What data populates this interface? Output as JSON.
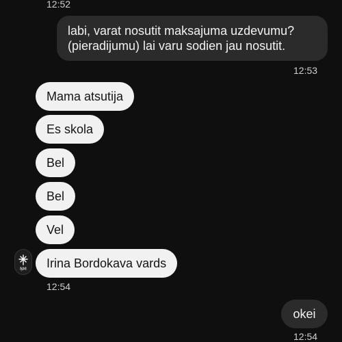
{
  "messages": {
    "ts_top": "12:52",
    "outgoing_1": {
      "line1": "labi, varat nosutit maksajuma uzdevumu?",
      "line2": "(pieradijumu) lai varu sodien jau nosutit.",
      "time": "12:53"
    },
    "incoming": [
      "Mama atsutija",
      "Es skola",
      "Bel",
      "Bel",
      "Vel",
      "Irina Bordokava vards"
    ],
    "incoming_time": "12:54",
    "outgoing_2": {
      "text": "okei",
      "time": "12:54"
    }
  },
  "avatar": {
    "icon": "monogram-logo-icon",
    "label": "ŅM"
  },
  "colors": {
    "background": "#0f0f0f",
    "outgoing_bubble": "#2b2b2b",
    "incoming_bubble": "#f1f1f1",
    "timestamp": "#cfcfcf"
  }
}
